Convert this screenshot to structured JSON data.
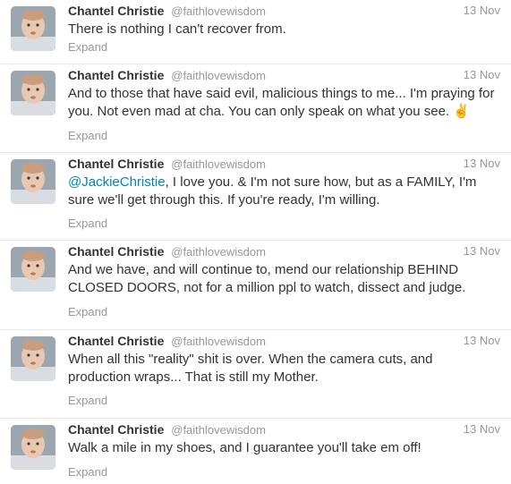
{
  "tweets": [
    {
      "name": "Chantel Christie",
      "handle": "@faithlovewisdom",
      "time": "13 Nov",
      "text": "There is nothing I can't recover from.",
      "expand": "Expand"
    },
    {
      "name": "Chantel Christie",
      "handle": "@faithlovewisdom",
      "time": "13 Nov",
      "text": "And to those that have said evil, malicious things to me... I'm praying for you. Not even mad at cha. You can only speak on what you see. ✌",
      "expand": "Expand"
    },
    {
      "name": "Chantel Christie",
      "handle": "@faithlovewisdom",
      "time": "13 Nov",
      "mention": "@JackieChristie",
      "text": ", I love you. & I'm not sure how, but as a FAMILY, I'm sure we'll get through this. If you're ready, I'm willing.",
      "expand": "Expand"
    },
    {
      "name": "Chantel Christie",
      "handle": "@faithlovewisdom",
      "time": "13 Nov",
      "text": "And we have, and will continue to, mend our relationship BEHIND CLOSED DOORS, not for a million ppl to watch, dissect and judge.",
      "expand": "Expand"
    },
    {
      "name": "Chantel Christie",
      "handle": "@faithlovewisdom",
      "time": "13 Nov",
      "text": "When all this \"reality\" shit is over. When the camera cuts, and production wraps... That is still my Mother.",
      "expand": "Expand"
    },
    {
      "name": "Chantel Christie",
      "handle": "@faithlovewisdom",
      "time": "13 Nov",
      "text": "Walk a mile in my shoes, and I guarantee you'll take em off!",
      "expand": "Expand"
    }
  ]
}
